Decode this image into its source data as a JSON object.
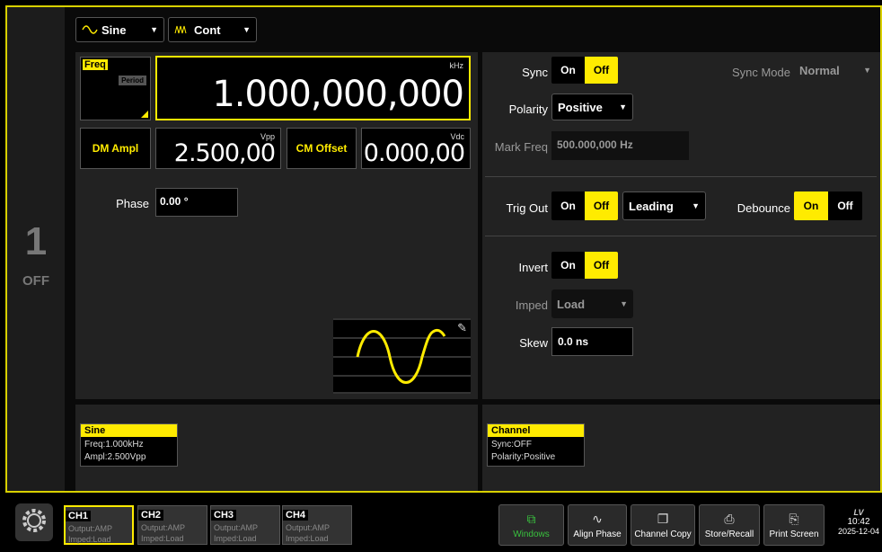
{
  "channel": {
    "number": "1",
    "state": "OFF"
  },
  "waveform": {
    "type_label": "Sine",
    "mode_label": "Cont"
  },
  "freq": {
    "label": "Freq",
    "alt_label": "Period",
    "value": "1.000,000,000",
    "unit": "kHz"
  },
  "ampl": {
    "label": "DM Ampl",
    "value": "2.500,00",
    "unit": "Vpp"
  },
  "offset": {
    "label": "CM Offset",
    "value": "0.000,00",
    "unit": "Vdc"
  },
  "phase": {
    "label": "Phase",
    "value": "0.00 °"
  },
  "sync": {
    "label": "Sync",
    "on": "On",
    "off": "Off",
    "mode_label": "Sync Mode",
    "mode_value": "Normal"
  },
  "polarity": {
    "label": "Polarity",
    "value": "Positive"
  },
  "mark_freq": {
    "label": "Mark Freq",
    "value": "500.000,000 Hz"
  },
  "trig_out": {
    "label": "Trig Out",
    "on": "On",
    "off": "Off",
    "edge": "Leading"
  },
  "debounce": {
    "label": "Debounce",
    "on": "On",
    "off": "Off"
  },
  "invert": {
    "label": "Invert",
    "on": "On",
    "off": "Off"
  },
  "imped": {
    "label": "Imped",
    "value": "Load"
  },
  "skew": {
    "label": "Skew",
    "value": "0.0 ns"
  },
  "info_wave": {
    "title": "Sine",
    "line1": "Freq:1.000kHz",
    "line2": "Ampl:2.500Vpp"
  },
  "info_channel": {
    "title": "Channel",
    "line1": "Sync:OFF",
    "line2": "Polarity:Positive"
  },
  "tabs": [
    {
      "name": "CH1",
      "output": "Output:AMP",
      "imped": "Imped:Load"
    },
    {
      "name": "CH2",
      "output": "Output:AMP",
      "imped": "Imped:Load"
    },
    {
      "name": "CH3",
      "output": "Output:AMP",
      "imped": "Imped:Load"
    },
    {
      "name": "CH4",
      "output": "Output:AMP",
      "imped": "Imped:Load"
    }
  ],
  "functions": {
    "windows": "Windows",
    "align_phase": "Align Phase",
    "channel_copy": "Channel Copy",
    "store_recall": "Store/Recall",
    "print_screen": "Print Screen"
  },
  "status": {
    "brand": "LV",
    "time": "10:42",
    "date": "2025-12-04"
  },
  "colors": {
    "accent": "#ffeb00",
    "panel": "#222222",
    "border": "#d8d000",
    "wave": "#ffeb00"
  },
  "icons": [
    "sine-icon",
    "burst-icon",
    "caret-down-icon",
    "edit-icon",
    "gear-icon",
    "windows-icon",
    "align-phase-icon",
    "copy-icon",
    "store-icon",
    "print-icon"
  ]
}
